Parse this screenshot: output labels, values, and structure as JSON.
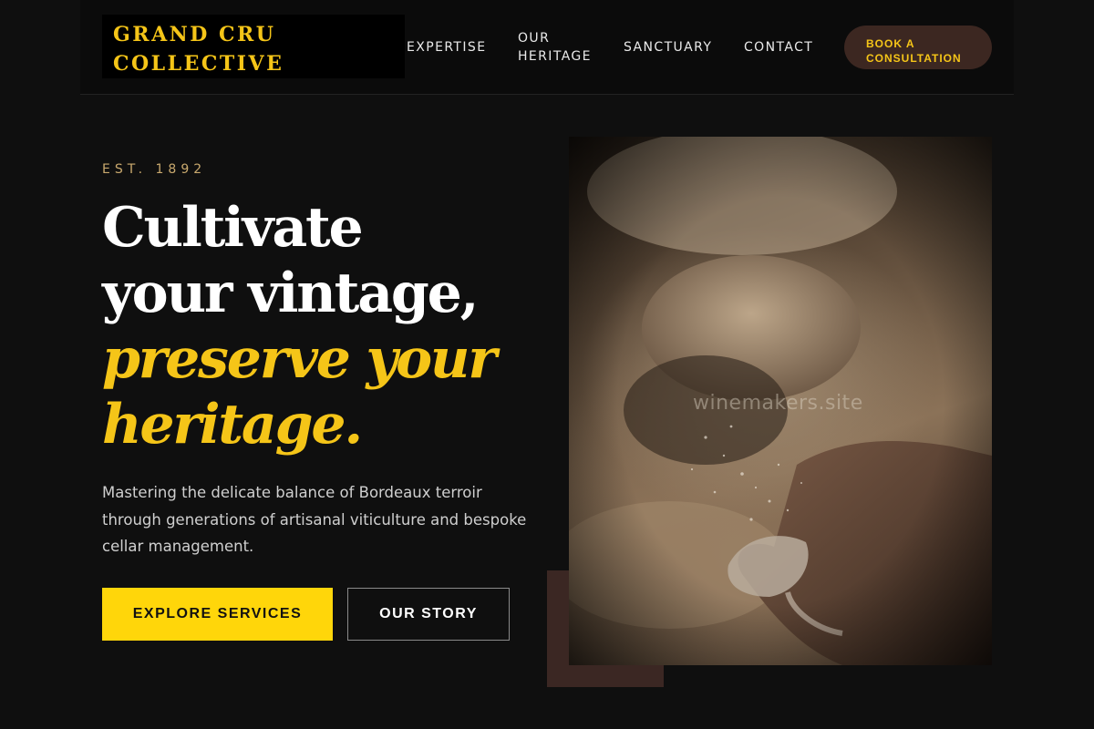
{
  "brand": {
    "name_line1": "GRAND CRU",
    "name_line2": "COLLECTIVE"
  },
  "nav": {
    "expertise": "EXPERTISE",
    "heritage_line1": "OUR",
    "heritage_line2": "HERITAGE",
    "sanctuary": "SANCTUARY",
    "contact": "CONTACT",
    "cta_line1": "BOOK A",
    "cta_line2": "CONSULTATION"
  },
  "hero": {
    "eyebrow": "EST. 1892",
    "headline_line1": "Cultivate",
    "headline_line2": "your vintage,",
    "headline_accent_line1": "preserve your",
    "headline_accent_line2": "heritage.",
    "lead": "Mastering the delicate balance of Bordeaux terroir through generations of artisanal viticulture and bespoke cellar management.",
    "primary_button": "EXPLORE SERVICES",
    "secondary_button": "OUR STORY",
    "image_watermark": "winemakers.site"
  },
  "colors": {
    "background": "#0f0f0f",
    "gold": "#f5c518",
    "button_yellow": "#ffd60a",
    "burgundy": "#3c2721",
    "eyebrow": "#c9a96e"
  }
}
